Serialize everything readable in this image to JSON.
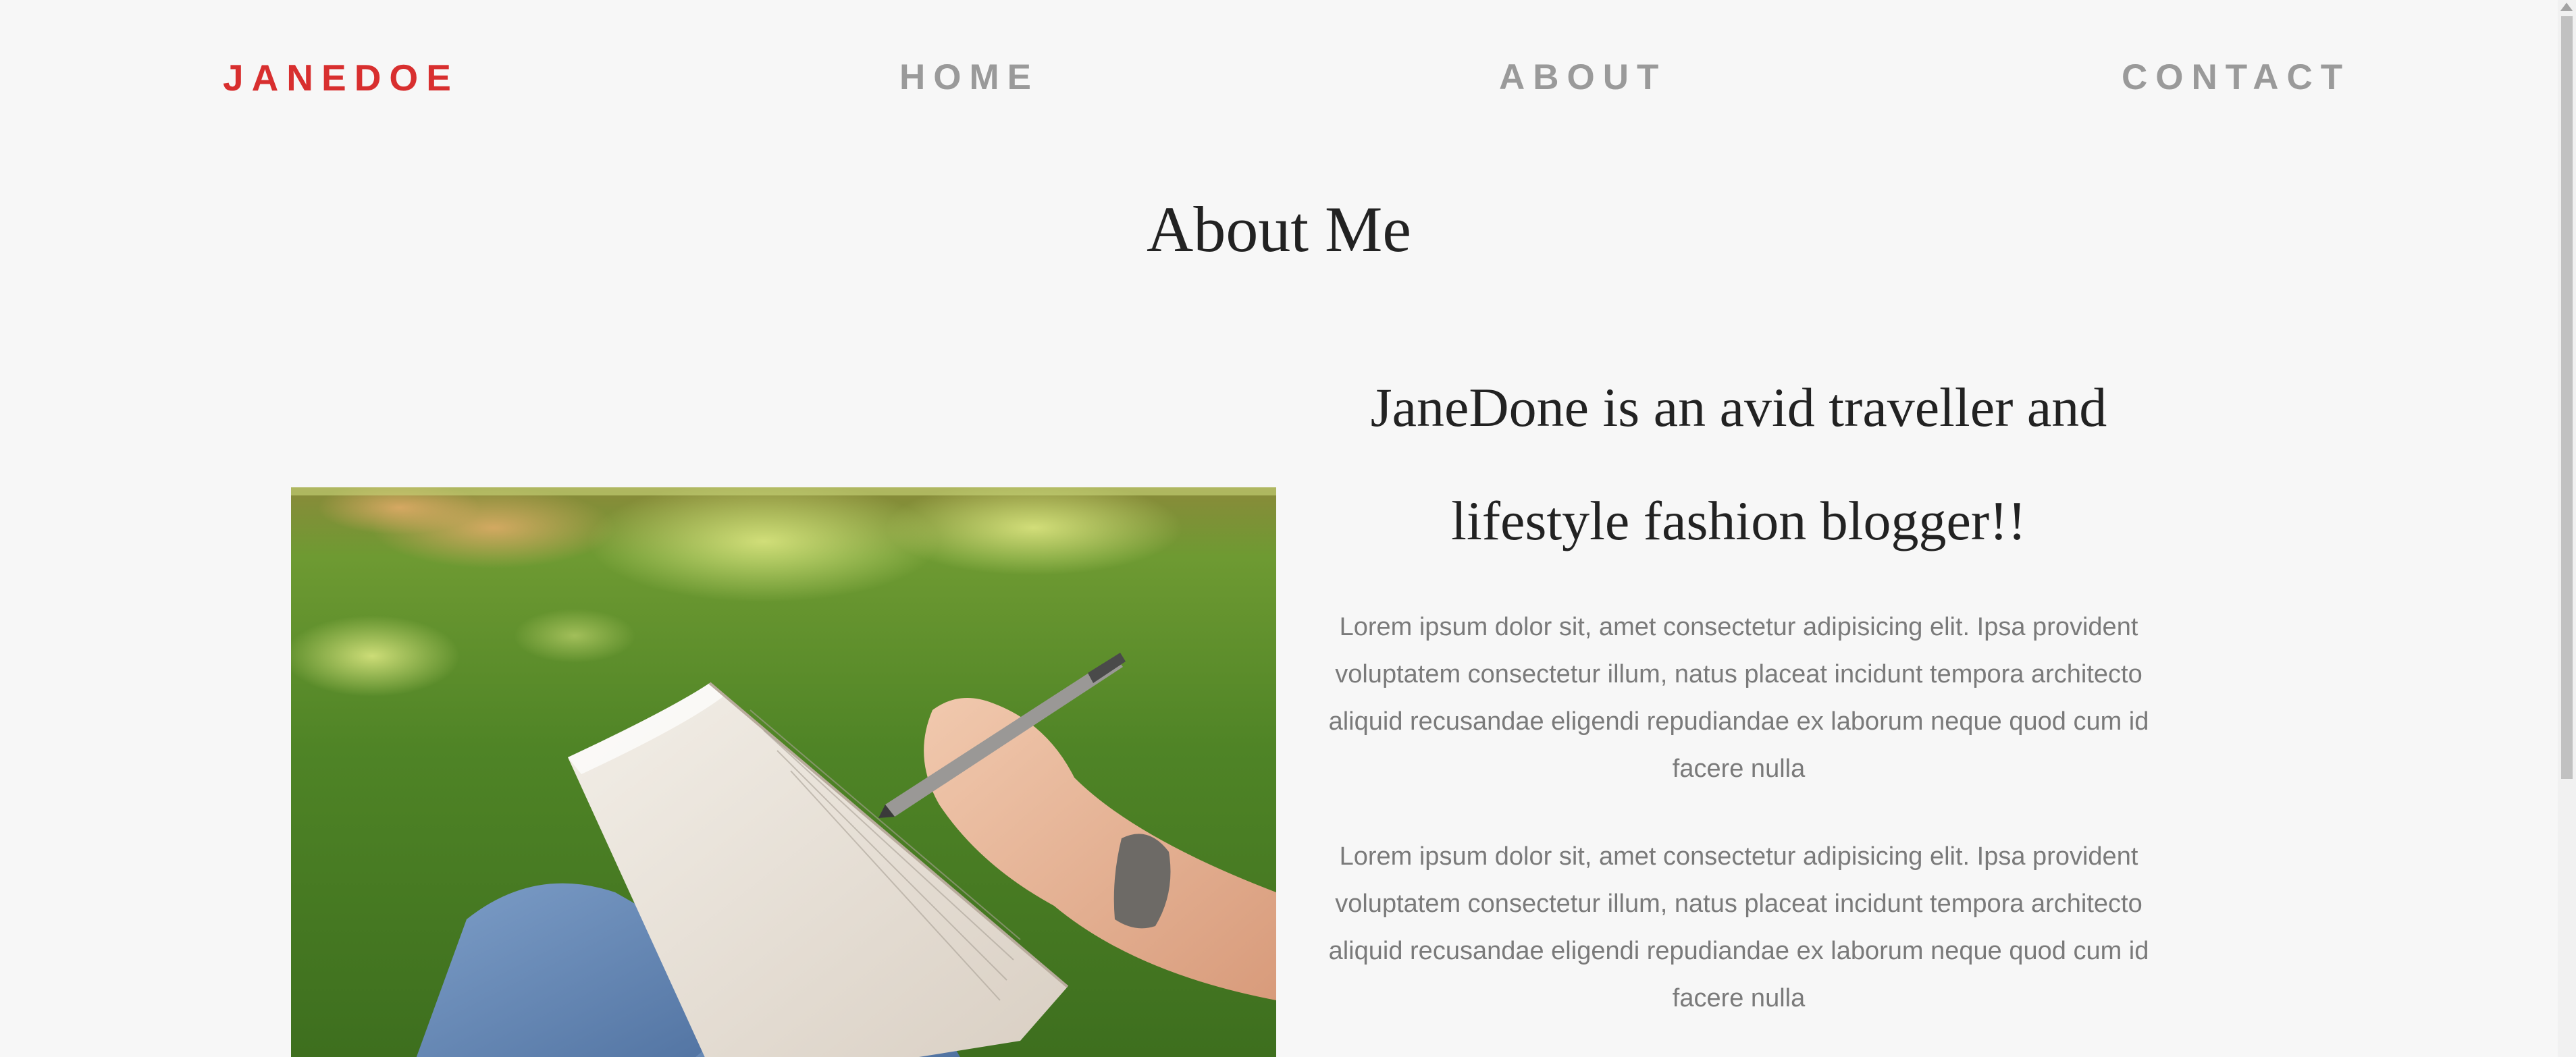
{
  "nav": {
    "brand": "JANEDOE",
    "links": [
      "HOME",
      "ABOUT",
      "CONTACT"
    ]
  },
  "about": {
    "title": "About Me",
    "tagline": "JaneDone is an avid traveller and lifestyle fashion blogger!!",
    "paragraphs": [
      "Lorem ipsum dolor sit, amet consectetur adipisicing elit. Ipsa provident voluptatem consectetur illum, natus placeat incidunt tempora architecto aliquid recusandae eligendi repudiandae ex laborum neque quod cum id facere nulla",
      "Lorem ipsum dolor sit, amet consectetur adipisicing elit. Ipsa provident voluptatem consectetur illum, natus placeat incidunt tempora architecto aliquid recusandae eligendi repudiandae ex laborum neque quod cum id facere nulla"
    ]
  },
  "colors": {
    "brand": "#d82f2f",
    "nav_link": "#9a9a9a",
    "heading": "#222222",
    "body_text": "#7a7a7a",
    "background": "#f7f7f7"
  }
}
